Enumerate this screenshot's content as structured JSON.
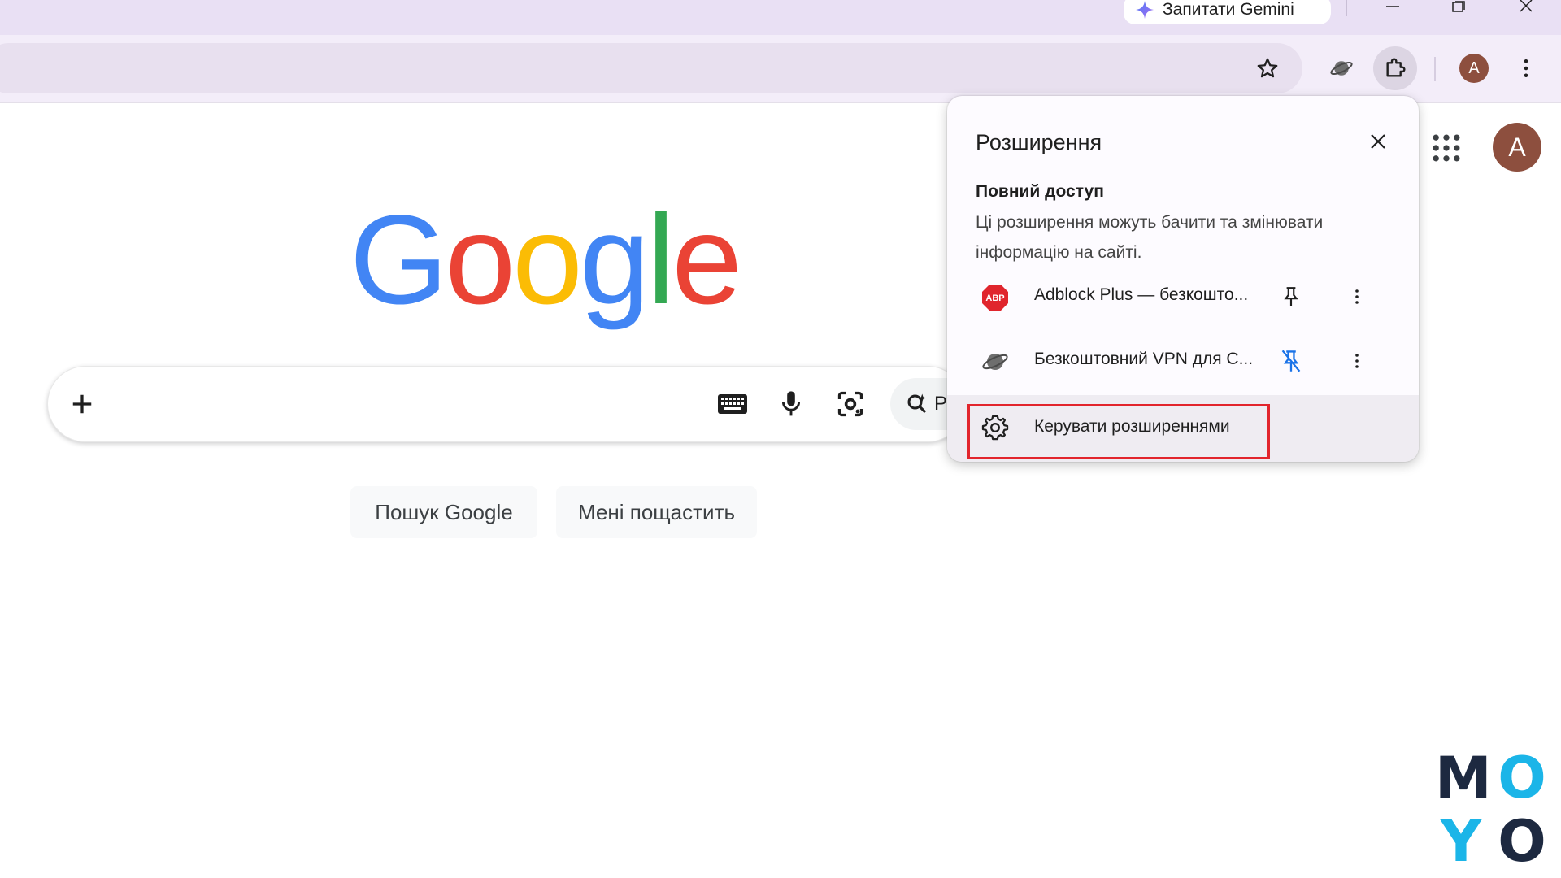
{
  "titlebar": {
    "gemini_label": "Запитати Gemini"
  },
  "toolbar": {
    "profile_initial": "A"
  },
  "page": {
    "logo_letters": [
      {
        "char": "G",
        "color": "#4285F4"
      },
      {
        "char": "o",
        "color": "#EA4335"
      },
      {
        "char": "o",
        "color": "#FBBC05"
      },
      {
        "char": "g",
        "color": "#4285F4"
      },
      {
        "char": "l",
        "color": "#34A853"
      },
      {
        "char": "e",
        "color": "#EA4335"
      }
    ],
    "avatar_initial": "A",
    "ai_chip_label": "Р",
    "search_button": "Пошук Google",
    "lucky_button": "Мені пощастить"
  },
  "extensions_popup": {
    "title": "Розширення",
    "section_title": "Повний доступ",
    "section_desc": "Ці розширення можуть бачити та змінювати інформацію на сайті.",
    "items": [
      {
        "name": "Adblock Plus — безкошто...",
        "icon": "abp-icon",
        "icon_text": "ABP",
        "pinned": false
      },
      {
        "name": "Безкоштовний VPN для C...",
        "icon": "planet-icon",
        "pinned": true
      }
    ],
    "manage_label": "Керувати розширеннями"
  },
  "watermark": {
    "letters": [
      "M",
      "O",
      "Y",
      "O"
    ],
    "colors": {
      "dark": "#1d2940",
      "accent": "#1bb5e8"
    }
  }
}
